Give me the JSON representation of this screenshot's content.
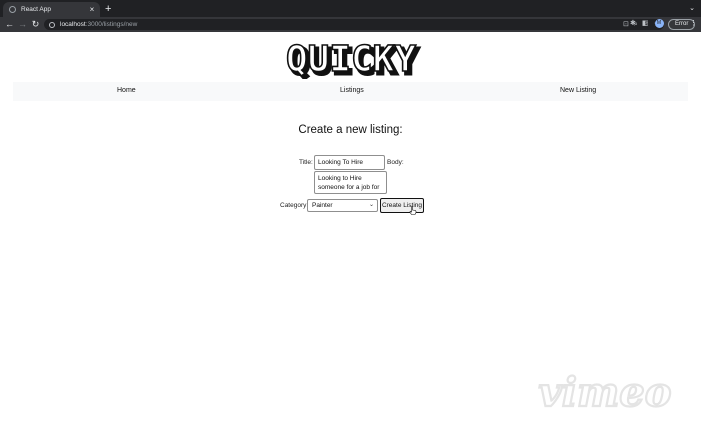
{
  "browser": {
    "tab_title": "React App",
    "tab_close_label": "×",
    "new_tab_label": "+",
    "tab_menu_label": "⌄",
    "back_label": "←",
    "forward_label": "→",
    "reload_label": "↻",
    "url_host": "localhost",
    "url_path": ":3000/listings/new",
    "profile_initial": "M",
    "error_label": "Error",
    "menu_label": "⋮"
  },
  "header": {
    "logo_text": "QUICKY"
  },
  "nav": {
    "items": [
      {
        "label": "Home"
      },
      {
        "label": "Listings"
      },
      {
        "label": "New Listing"
      }
    ]
  },
  "form": {
    "heading": "Create a new listing:",
    "title_label": "Title:",
    "title_value": "Looking To Hire",
    "body_label": "Body:",
    "body_value": "Looking to Hire someone for a job for tomorrow",
    "category_label": "Category:",
    "category_value": "Painter",
    "submit_label": "Create Listing"
  },
  "watermark": {
    "text": "vimeo"
  },
  "colors": {
    "chrome_dark": "#202124",
    "chrome_tab": "#35363a",
    "navbar_bg": "#f8f9fa"
  }
}
